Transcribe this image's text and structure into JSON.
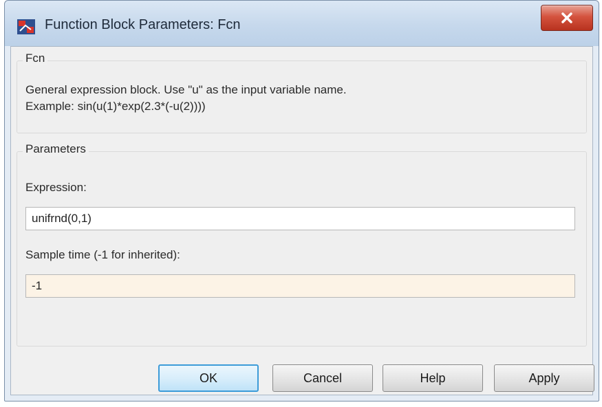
{
  "window": {
    "title": "Function Block Parameters: Fcn",
    "icon": "simulink-block-icon",
    "close_icon": "close-icon"
  },
  "description_group": {
    "legend": "Fcn",
    "line1": "General expression block. Use \"u\" as the input variable name.",
    "line2": "Example: sin(u(1)*exp(2.3*(-u(2))))"
  },
  "parameters_group": {
    "legend": "Parameters",
    "expression_label": "Expression:",
    "expression_value": "unifrnd(0,1)",
    "sample_time_label": "Sample time (-1 for inherited):",
    "sample_time_value": "-1"
  },
  "buttons": {
    "ok": "OK",
    "cancel": "Cancel",
    "help": "Help",
    "apply": "Apply"
  },
  "colors": {
    "close_button": "#c9432e",
    "default_button_border": "#3c9bd8",
    "sample_time_field_bg": "#fcf3e6"
  }
}
